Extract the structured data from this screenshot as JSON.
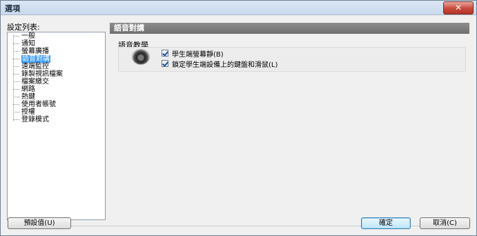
{
  "window": {
    "title": "選項",
    "close_symbol": "✕"
  },
  "tree": {
    "label": "設定列表:",
    "items": [
      {
        "label": "一般",
        "selected": false
      },
      {
        "label": "通知",
        "selected": false
      },
      {
        "label": "螢幕廣播",
        "selected": false
      },
      {
        "label": "語音對講",
        "selected": true
      },
      {
        "label": "遠端監控",
        "selected": false
      },
      {
        "label": "錄製視訊檔案",
        "selected": false
      },
      {
        "label": "檔案繳交",
        "selected": false
      },
      {
        "label": "網路",
        "selected": false
      },
      {
        "label": "熱鍵",
        "selected": false
      },
      {
        "label": "使用者帳號",
        "selected": false
      },
      {
        "label": "授權",
        "selected": false
      },
      {
        "label": "登錄模式",
        "selected": false
      }
    ]
  },
  "panel": {
    "header": "語音對講",
    "group_title": "語音教學",
    "icon": "speaker-icon",
    "checkboxes": [
      {
        "label": "學生端螢幕靜(B)",
        "checked": true
      },
      {
        "label": "鎖定學生端設備上的鍵盤和滑鼠(L)",
        "checked": true
      }
    ]
  },
  "footer": {
    "defaults_label": "預設值(U)",
    "ok_label": "確定",
    "cancel_label": "取消(C)"
  },
  "colors": {
    "selection": "#3399ff",
    "header_bg": "#7f7f7f",
    "close_bg": "#c9483a"
  }
}
